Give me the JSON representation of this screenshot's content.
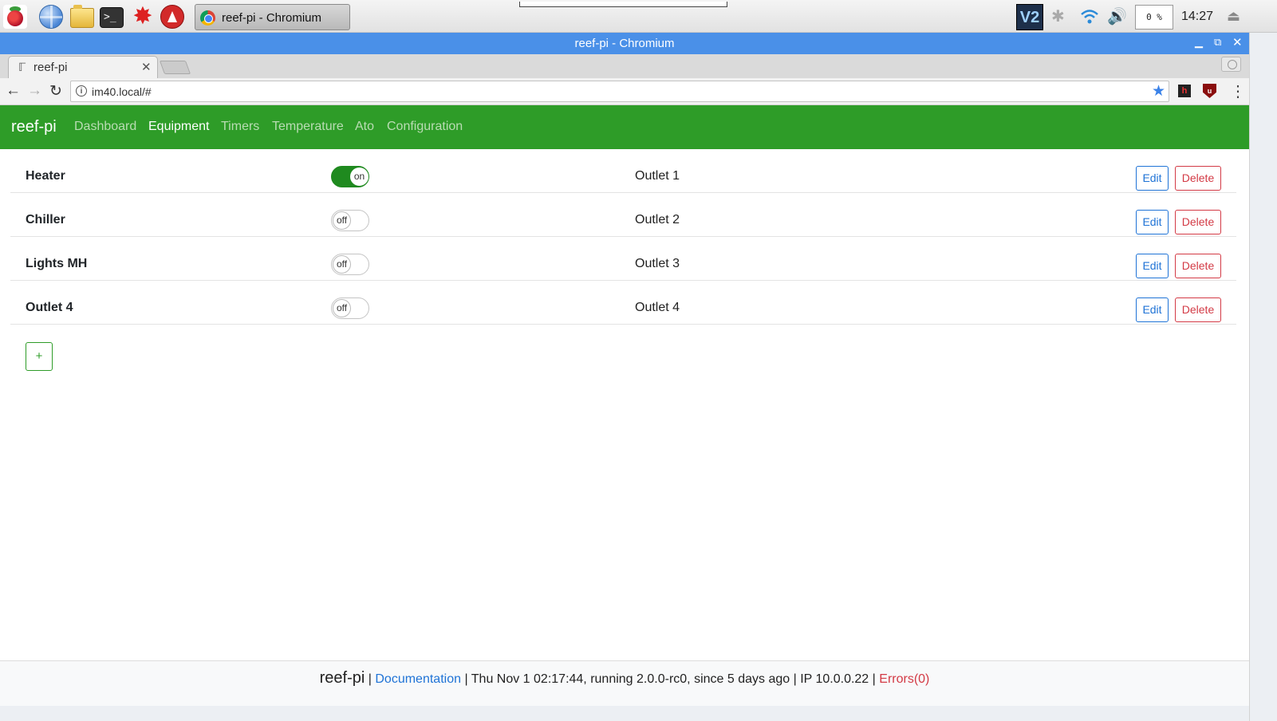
{
  "taskbar": {
    "terminal_glyph": ">_",
    "burst_glyph": "✸",
    "task_label": "reef-pi - Chromium",
    "vnc_label": "V2",
    "cpu_label": "0 %",
    "clock": "14:27"
  },
  "window": {
    "title": "reef-pi - Chromium"
  },
  "browser": {
    "tab_title": "reef-pi",
    "tab_favicon": "ℾ",
    "url": "im40.local/#",
    "ext1_label": "h",
    "ext2_label": "u"
  },
  "app": {
    "brand": "reef-pi",
    "nav": [
      "Dashboard",
      "Equipment",
      "Timers",
      "Temperature",
      "Ato",
      "Configuration"
    ],
    "active_nav": "Equipment",
    "accent_color": "#2e9c28",
    "equipment": [
      {
        "name": "Heater",
        "state": "on",
        "outlet": "Outlet 1"
      },
      {
        "name": "Chiller",
        "state": "off",
        "outlet": "Outlet 2"
      },
      {
        "name": "Lights MH",
        "state": "off",
        "outlet": "Outlet 3"
      },
      {
        "name": "Outlet 4",
        "state": "off",
        "outlet": "Outlet 4"
      }
    ],
    "edit_label": "Edit",
    "delete_label": "Delete",
    "add_label": "+"
  },
  "footer": {
    "brand": "reef-pi",
    "sep": "|",
    "documentation": "Documentation",
    "time": "Thu Nov 1 02:17:44,",
    "version": "running 2.0.0-rc0,",
    "uptime": "since 5 days ago",
    "ip": "IP 10.0.0.22",
    "errors": "Errors(0)"
  }
}
